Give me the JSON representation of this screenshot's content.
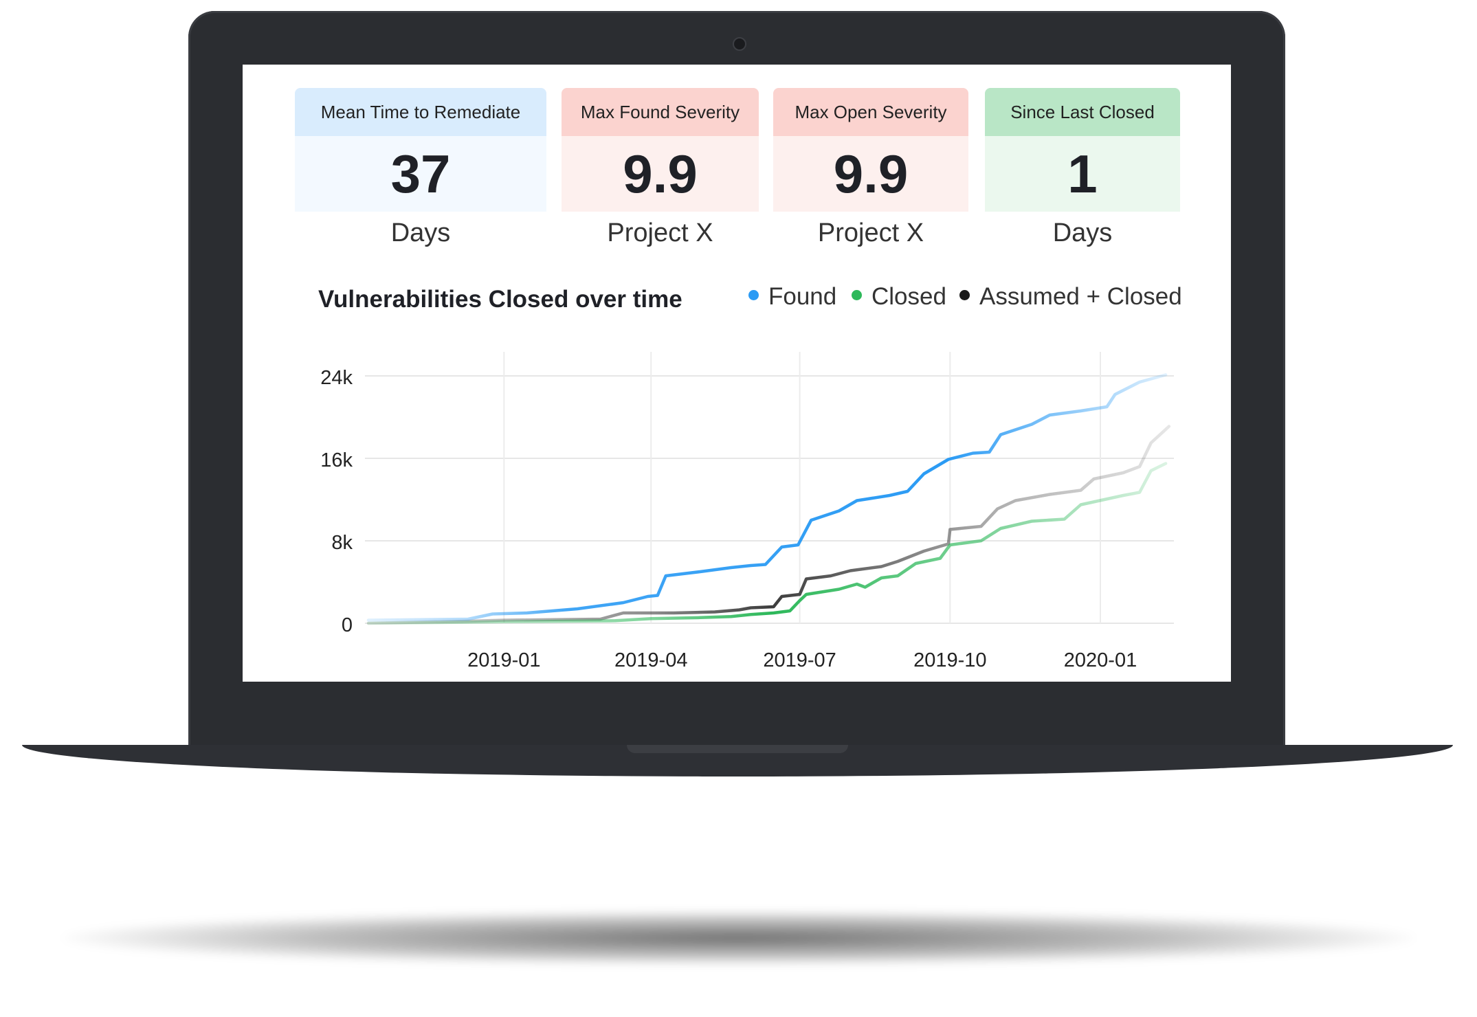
{
  "cards": [
    {
      "title": "Mean Time to Remediate",
      "value": "37",
      "sub": "Days",
      "head_color": "#d9ecfd",
      "body_color": "#f3f9ff"
    },
    {
      "title": "Max Found Severity",
      "value": "9.9",
      "sub": "Project X",
      "head_color": "#fbd3cf",
      "body_color": "#fdf0ee"
    },
    {
      "title": "Max Open Severity",
      "value": "9.9",
      "sub": "Project X",
      "head_color": "#fbd3cf",
      "body_color": "#fdf0ee"
    },
    {
      "title": "Since Last Closed",
      "value": "1",
      "sub": "Days",
      "head_color": "#b9e6c6",
      "body_color": "#ebf8ee"
    }
  ],
  "chart_data": {
    "type": "line",
    "title": "Vulnerabilities Closed over time",
    "y_ticks": [
      "24k",
      "16k",
      "8k",
      "0"
    ],
    "y_tick_values": [
      24000,
      16000,
      8000,
      0
    ],
    "x_ticks": [
      "2019-01",
      "2019-04",
      "2019-07",
      "2019-10",
      "2020-01"
    ],
    "x_tick_values": [
      "2019-01-01",
      "2019-04-01",
      "2019-07-01",
      "2019-10-01",
      "2020-01-01"
    ],
    "xlim": [
      "2018-10-10",
      "2020-02-15"
    ],
    "ylim": [
      0,
      25000
    ],
    "grid": true,
    "legend_position": "top-right",
    "series": [
      {
        "name": "Found",
        "color": "#2b9bf4",
        "points": [
          [
            "2018-10-10",
            300
          ],
          [
            "2018-12-10",
            400
          ],
          [
            "2018-12-25",
            900
          ],
          [
            "2019-01-15",
            1000
          ],
          [
            "2019-02-15",
            1400
          ],
          [
            "2019-03-15",
            2000
          ],
          [
            "2019-03-30",
            2600
          ],
          [
            "2019-04-05",
            2700
          ],
          [
            "2019-04-10",
            4600
          ],
          [
            "2019-05-01",
            5000
          ],
          [
            "2019-05-20",
            5400
          ],
          [
            "2019-06-01",
            5600
          ],
          [
            "2019-06-10",
            5700
          ],
          [
            "2019-06-20",
            7400
          ],
          [
            "2019-06-30",
            7600
          ],
          [
            "2019-07-08",
            10000
          ],
          [
            "2019-07-25",
            10900
          ],
          [
            "2019-08-05",
            11900
          ],
          [
            "2019-08-25",
            12400
          ],
          [
            "2019-09-05",
            12800
          ],
          [
            "2019-09-15",
            14500
          ],
          [
            "2019-09-30",
            15900
          ],
          [
            "2019-10-15",
            16500
          ],
          [
            "2019-10-25",
            16600
          ],
          [
            "2019-11-01",
            18300
          ],
          [
            "2019-11-20",
            19300
          ],
          [
            "2019-12-01",
            20200
          ],
          [
            "2019-12-20",
            20600
          ],
          [
            "2020-01-05",
            21000
          ],
          [
            "2020-01-10",
            22200
          ],
          [
            "2020-01-25",
            23400
          ],
          [
            "2020-02-10",
            24100
          ]
        ]
      },
      {
        "name": "Closed",
        "color": "#2db85a",
        "points": [
          [
            "2018-10-10",
            0
          ],
          [
            "2018-12-10",
            100
          ],
          [
            "2019-01-01",
            150
          ],
          [
            "2019-03-10",
            250
          ],
          [
            "2019-04-01",
            450
          ],
          [
            "2019-05-01",
            550
          ],
          [
            "2019-05-20",
            650
          ],
          [
            "2019-06-01",
            850
          ],
          [
            "2019-06-15",
            1000
          ],
          [
            "2019-06-25",
            1200
          ],
          [
            "2019-07-01",
            2200
          ],
          [
            "2019-07-05",
            2800
          ],
          [
            "2019-07-25",
            3300
          ],
          [
            "2019-08-05",
            3800
          ],
          [
            "2019-08-10",
            3500
          ],
          [
            "2019-08-20",
            4400
          ],
          [
            "2019-08-30",
            4600
          ],
          [
            "2019-09-10",
            5800
          ],
          [
            "2019-09-25",
            6300
          ],
          [
            "2019-10-01",
            7600
          ],
          [
            "2019-10-20",
            8000
          ],
          [
            "2019-11-01",
            9200
          ],
          [
            "2019-11-20",
            9900
          ],
          [
            "2019-12-10",
            10100
          ],
          [
            "2019-12-20",
            11500
          ],
          [
            "2020-01-15",
            12400
          ],
          [
            "2020-01-25",
            12700
          ],
          [
            "2020-02-01",
            14800
          ],
          [
            "2020-02-10",
            15500
          ]
        ]
      },
      {
        "name": "Assumed + Closed",
        "color": "#1a1a1a",
        "points": [
          [
            "2018-10-10",
            0
          ],
          [
            "2018-12-10",
            200
          ],
          [
            "2019-01-01",
            300
          ],
          [
            "2019-03-01",
            400
          ],
          [
            "2019-03-15",
            1000
          ],
          [
            "2019-04-15",
            1000
          ],
          [
            "2019-05-10",
            1100
          ],
          [
            "2019-05-25",
            1300
          ],
          [
            "2019-06-01",
            1500
          ],
          [
            "2019-06-15",
            1600
          ],
          [
            "2019-06-20",
            2600
          ],
          [
            "2019-07-01",
            2800
          ],
          [
            "2019-07-05",
            4300
          ],
          [
            "2019-07-20",
            4600
          ],
          [
            "2019-08-01",
            5100
          ],
          [
            "2019-08-20",
            5500
          ],
          [
            "2019-08-30",
            6000
          ],
          [
            "2019-09-15",
            7000
          ],
          [
            "2019-09-30",
            7700
          ],
          [
            "2019-10-01",
            9100
          ],
          [
            "2019-10-20",
            9400
          ],
          [
            "2019-10-30",
            11100
          ],
          [
            "2019-11-10",
            11900
          ],
          [
            "2019-12-01",
            12500
          ],
          [
            "2019-12-20",
            12900
          ],
          [
            "2019-12-28",
            14000
          ],
          [
            "2020-01-15",
            14600
          ],
          [
            "2020-01-25",
            15200
          ],
          [
            "2020-02-01",
            17500
          ],
          [
            "2020-02-12",
            19100
          ]
        ]
      }
    ]
  }
}
